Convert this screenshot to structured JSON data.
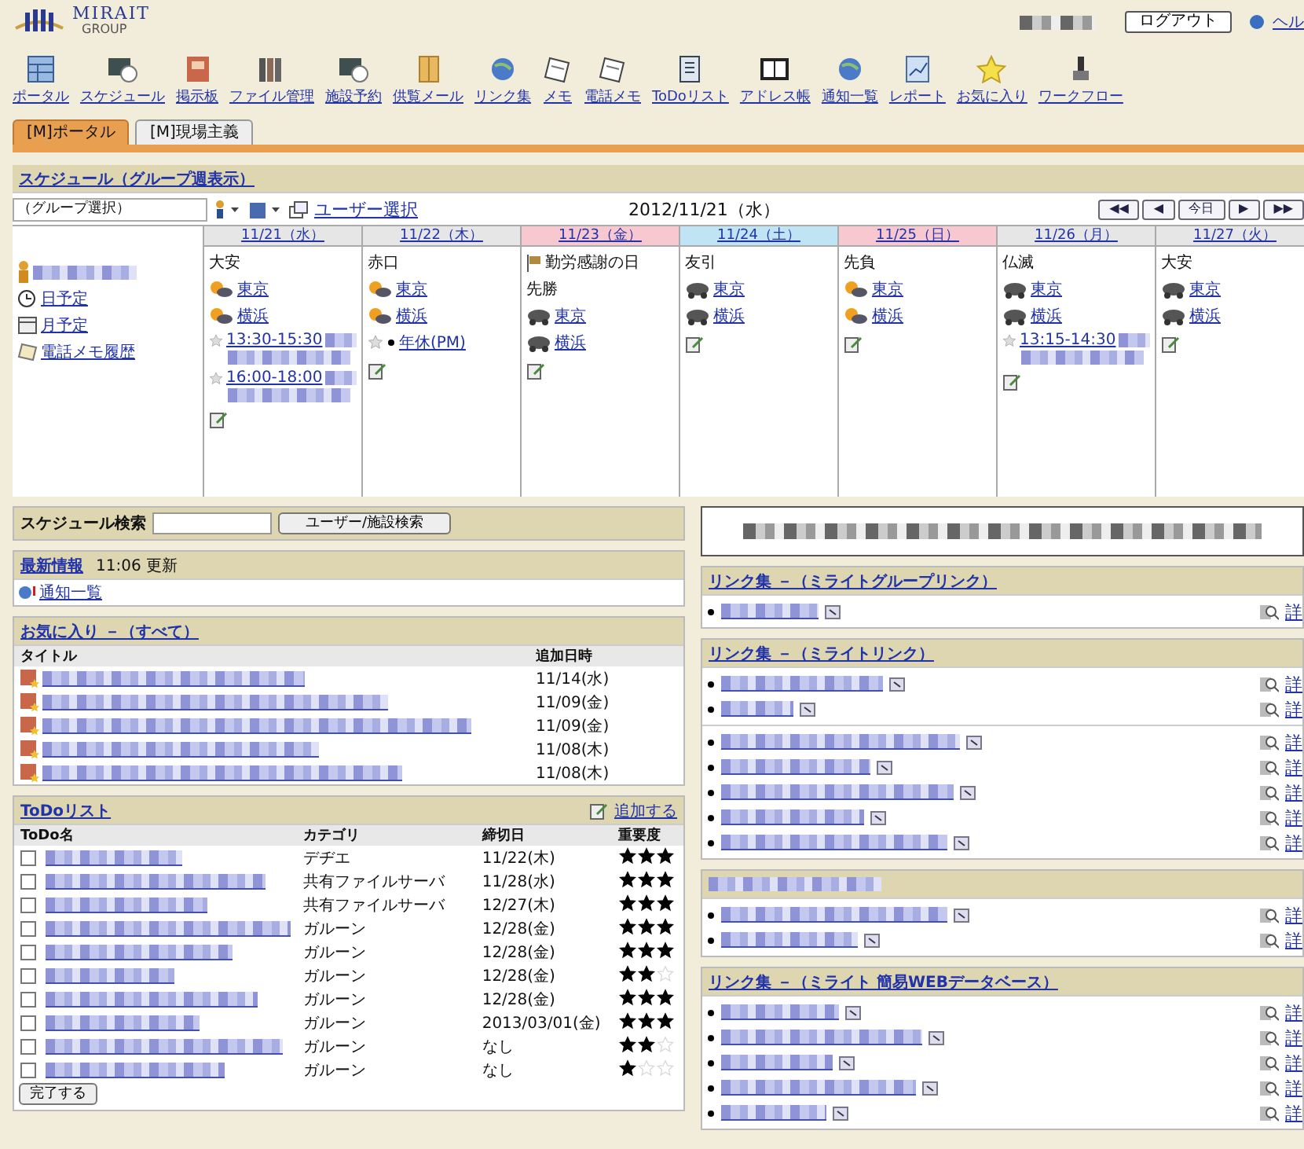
{
  "header": {
    "logo_name": "MIRAIT",
    "logo_sub": "GROUP",
    "logout": "ログアウト",
    "help": "ヘル"
  },
  "toolbar": [
    {
      "label": "ポータル",
      "kind": "grid"
    },
    {
      "label": "スケジュール",
      "kind": "clock"
    },
    {
      "label": "掲示板",
      "kind": "board"
    },
    {
      "label": "ファイル管理",
      "kind": "books"
    },
    {
      "label": "施設予約",
      "kind": "clock"
    },
    {
      "label": "供覧メール",
      "kind": "envelope"
    },
    {
      "label": "リンク集",
      "kind": "globe"
    },
    {
      "label": "メモ",
      "kind": "memo"
    },
    {
      "label": "電話メモ",
      "kind": "memo"
    },
    {
      "label": "ToDoリスト",
      "kind": "doc"
    },
    {
      "label": "アドレス帳",
      "kind": "book"
    },
    {
      "label": "通知一覧",
      "kind": "globe"
    },
    {
      "label": "レポート",
      "kind": "chart"
    },
    {
      "label": "お気に入り",
      "kind": "star"
    },
    {
      "label": "ワークフロー",
      "kind": "stamp"
    }
  ],
  "tabs": [
    {
      "label": "[M]ポータル",
      "selected": true
    },
    {
      "label": "[M]現場主義",
      "selected": false
    }
  ],
  "schedule": {
    "title": "スケジュール（グループ週表示）",
    "group_select": "（グループ選択）",
    "user_select": "ユーザー選択",
    "date": "2012/11/21（水）",
    "nav": [
      "◀◀",
      "◀",
      "今日",
      "▶",
      "▶▶"
    ],
    "side_links": [
      {
        "label": "日予定",
        "kind": "clock"
      },
      {
        "label": "月予定",
        "kind": "calendar"
      },
      {
        "label": "電話メモ履歴",
        "kind": "memo"
      }
    ],
    "days": [
      {
        "date": "11/21（水）",
        "kind": "weekday",
        "rokuyo": "大安",
        "weather": [
          {
            "city": "東京",
            "kind": "sun"
          },
          {
            "city": "横浜",
            "kind": "sun"
          }
        ],
        "events": [
          {
            "kind": "timed",
            "text": "13:30-15:30"
          },
          {
            "kind": "timed",
            "text": "16:00-18:00"
          }
        ]
      },
      {
        "date": "11/22（木）",
        "kind": "weekday",
        "rokuyo": "赤口",
        "weather": [
          {
            "city": "東京",
            "kind": "sun"
          },
          {
            "city": "横浜",
            "kind": "sun"
          }
        ],
        "events": [
          {
            "kind": "plain",
            "text": "年休(PM)"
          }
        ]
      },
      {
        "date": "11/23（金）",
        "kind": "holiday",
        "holiday": "勤労感謝の日",
        "rokuyo": "先勝",
        "weather": [
          {
            "city": "東京",
            "kind": "cloud"
          },
          {
            "city": "横浜",
            "kind": "cloud"
          }
        ]
      },
      {
        "date": "11/24（土）",
        "kind": "saturday",
        "rokuyo": "友引",
        "weather": [
          {
            "city": "東京",
            "kind": "cloud"
          },
          {
            "city": "横浜",
            "kind": "cloud"
          }
        ]
      },
      {
        "date": "11/25（日）",
        "kind": "holiday",
        "rokuyo": "先負",
        "weather": [
          {
            "city": "東京",
            "kind": "sun"
          },
          {
            "city": "横浜",
            "kind": "sun"
          }
        ]
      },
      {
        "date": "11/26（月）",
        "kind": "weekday",
        "rokuyo": "仏滅",
        "weather": [
          {
            "city": "東京",
            "kind": "cloud"
          },
          {
            "city": "横浜",
            "kind": "cloud"
          }
        ],
        "events": [
          {
            "kind": "timed",
            "text": "13:15-14:30"
          }
        ]
      },
      {
        "date": "11/27（火）",
        "kind": "weekday",
        "rokuyo": "大安",
        "weather": [
          {
            "city": "東京",
            "kind": "cloud"
          },
          {
            "city": "横浜",
            "kind": "cloud"
          }
        ]
      }
    ]
  },
  "search": {
    "label": "スケジュール検索",
    "button": "ユーザー/施設検索"
  },
  "news": {
    "title": "最新情報",
    "time": "11:06 更新",
    "link": "通知一覧"
  },
  "favorites": {
    "title": "お気に入り －（すべて）",
    "columns": [
      "タイトル",
      "追加日時"
    ],
    "rows": [
      {
        "date": "11/14(水)"
      },
      {
        "date": "11/09(金)"
      },
      {
        "date": "11/09(金)"
      },
      {
        "date": "11/08(木)"
      },
      {
        "date": "11/08(木)"
      }
    ]
  },
  "todo": {
    "title": "ToDoリスト",
    "add": "追加する",
    "columns": [
      "ToDo名",
      "カテゴリ",
      "締切日",
      "重要度"
    ],
    "rows": [
      {
        "checked": false,
        "category": "デヂエ",
        "due": "11/22(木)",
        "stars": 3
      },
      {
        "checked": false,
        "category": "共有ファイルサーバ",
        "due": "11/28(水)",
        "stars": 3
      },
      {
        "checked": false,
        "category": "共有ファイルサーバ",
        "due": "12/27(木)",
        "stars": 3
      },
      {
        "checked": false,
        "category": "ガルーン",
        "due": "12/28(金)",
        "stars": 3
      },
      {
        "checked": false,
        "category": "ガルーン",
        "due": "12/28(金)",
        "stars": 3
      },
      {
        "checked": false,
        "category": "ガルーン",
        "due": "12/28(金)",
        "stars": 2
      },
      {
        "checked": false,
        "category": "ガルーン",
        "due": "12/28(金)",
        "stars": 3
      },
      {
        "checked": false,
        "category": "ガルーン",
        "due": "2013/03/01(金)",
        "stars": 3
      },
      {
        "checked": false,
        "category": "ガルーン",
        "due": "なし",
        "stars": 2
      },
      {
        "checked": false,
        "category": "ガルーン",
        "due": "なし",
        "stars": 1
      }
    ],
    "done_button": "完了する"
  },
  "link_sections": [
    {
      "title": "リンク集 －（ミライトグループリンク）",
      "groups": [
        [
          {
            "detail": "詳"
          }
        ]
      ]
    },
    {
      "title": "リンク集 －（ミライトリンク）",
      "groups": [
        [
          {
            "detail": "詳"
          },
          {
            "detail": "詳"
          }
        ],
        [
          {
            "detail": "詳"
          },
          {
            "detail": "詳"
          },
          {
            "detail": "詳"
          },
          {
            "detail": "詳"
          },
          {
            "detail": "詳"
          }
        ]
      ]
    },
    {
      "groups": [
        [
          {
            "detail": "詳"
          },
          {
            "detail": "詳"
          }
        ]
      ]
    },
    {
      "title": "リンク集 －（ミライト 簡易WEBデータベース）",
      "groups": [
        [
          {
            "detail": "詳"
          },
          {
            "detail": "詳"
          },
          {
            "detail": "詳"
          },
          {
            "detail": "詳"
          },
          {
            "detail": "詳"
          }
        ]
      ]
    }
  ]
}
